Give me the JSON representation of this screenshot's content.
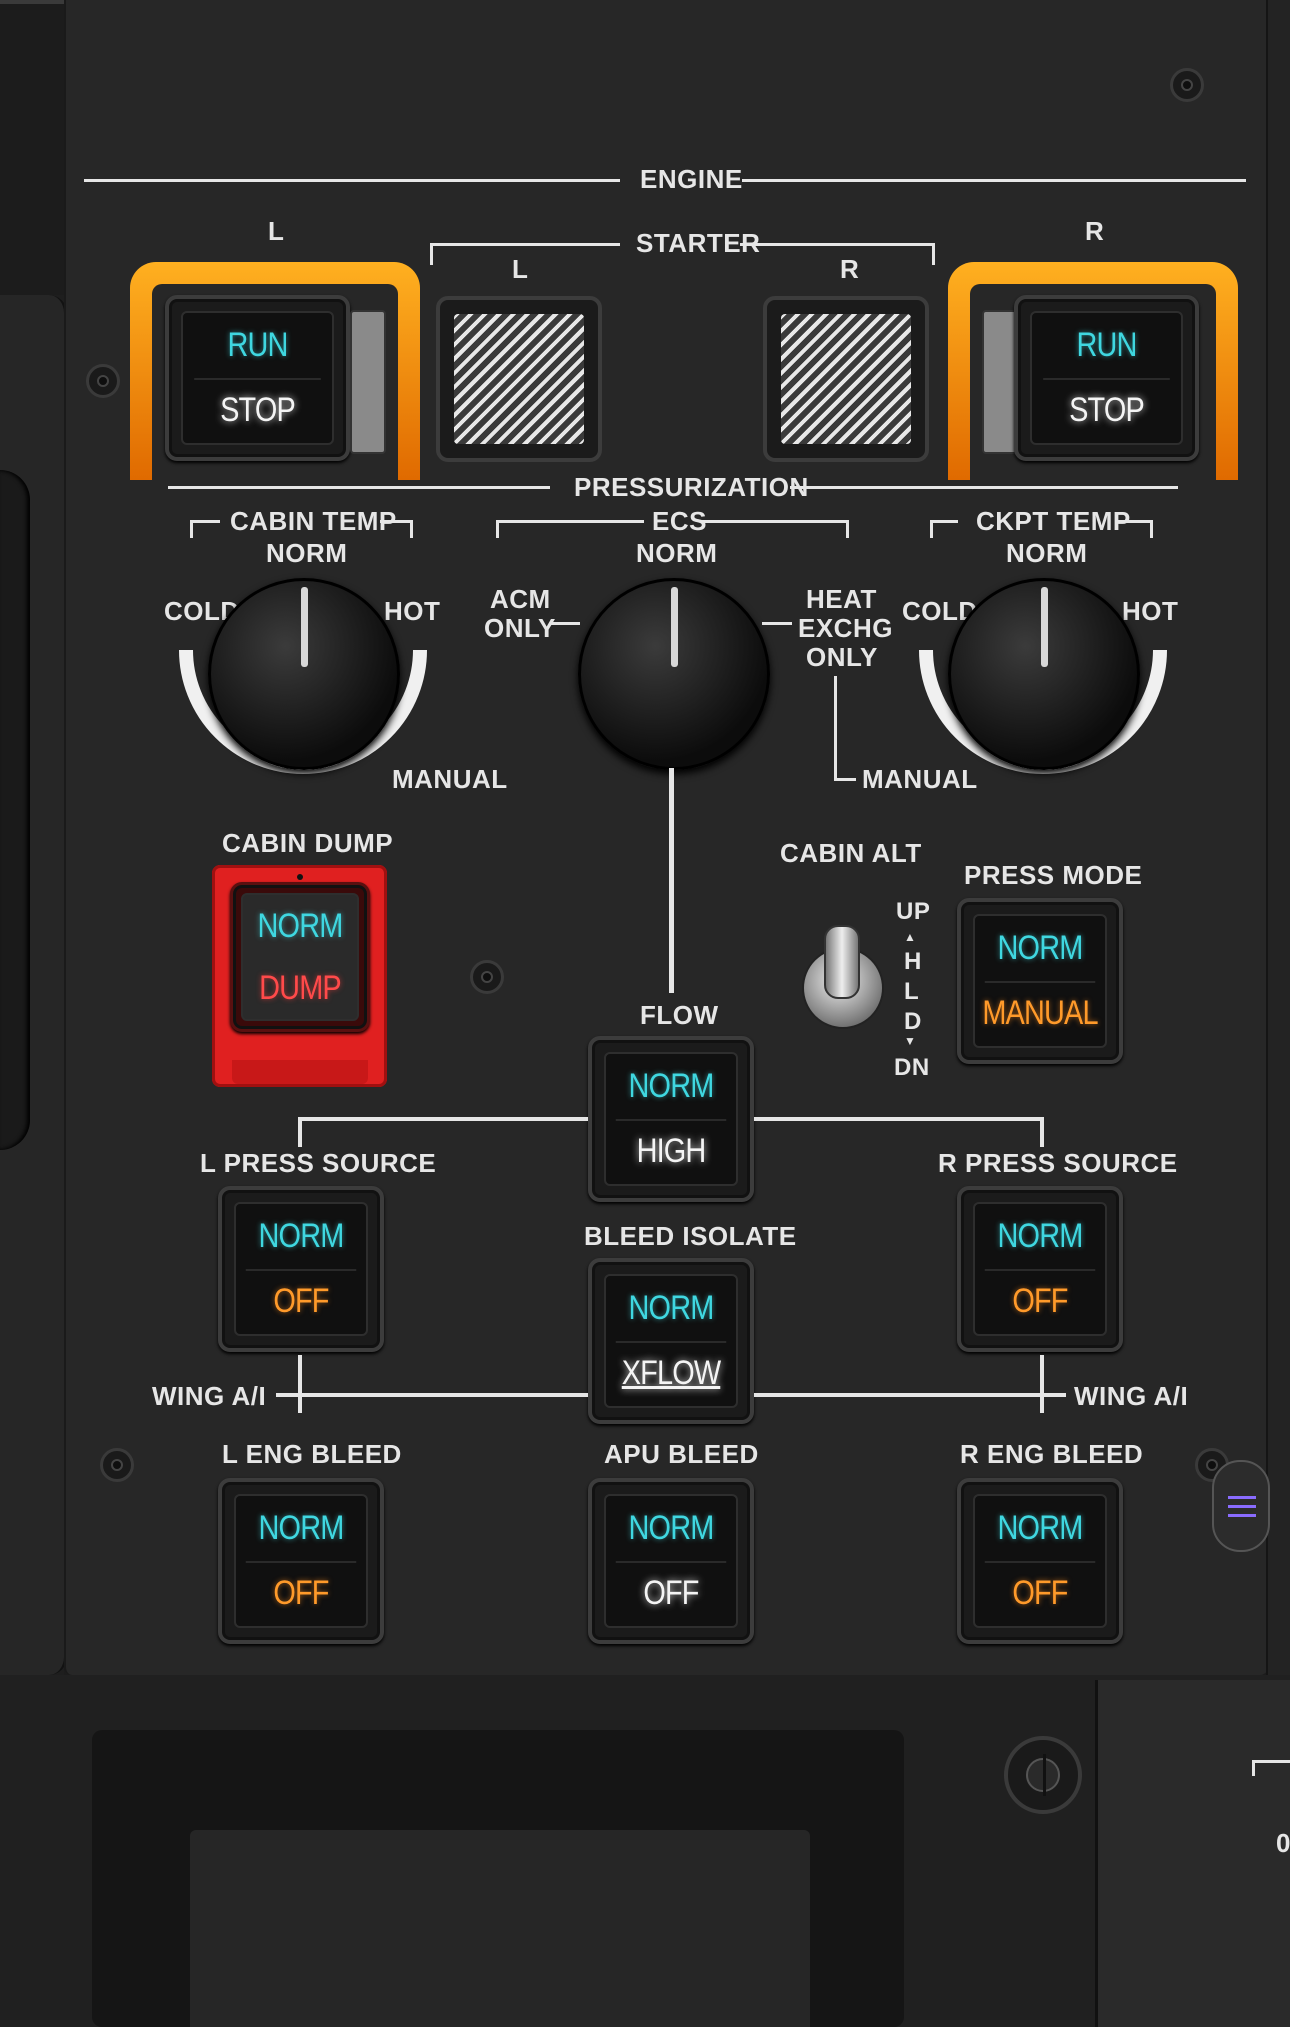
{
  "engine": {
    "title": "ENGINE",
    "left_label": "L",
    "right_label": "R",
    "starter_title": "STARTER",
    "starter_left": "L",
    "starter_right": "R",
    "left_switch": {
      "top": "RUN",
      "bottom": "STOP"
    },
    "right_switch": {
      "top": "RUN",
      "bottom": "STOP"
    }
  },
  "pressurization": {
    "title": "PRESSURIZATION",
    "cabin_temp": {
      "title": "CABIN TEMP",
      "norm": "NORM",
      "cold": "COLD",
      "hot": "HOT",
      "manual": "MANUAL"
    },
    "ecs": {
      "title": "ECS",
      "norm": "NORM",
      "acm_only_1": "ACM",
      "acm_only_2": "ONLY",
      "heat_1": "HEAT",
      "heat_2": "EXCHG",
      "heat_3": "ONLY",
      "manual": "MANUAL"
    },
    "ckpt_temp": {
      "title": "CKPT TEMP",
      "norm": "NORM",
      "cold": "COLD",
      "hot": "HOT"
    }
  },
  "cabin_dump": {
    "title": "CABIN DUMP",
    "top": "NORM",
    "bottom": "DUMP"
  },
  "cabin_alt": {
    "title": "CABIN ALT",
    "up": "UP",
    "hld_h": "H",
    "hld_l": "L",
    "hld_d": "D",
    "dn": "DN"
  },
  "press_mode": {
    "title": "PRESS MODE",
    "top": "NORM",
    "bottom": "MANUAL"
  },
  "flow": {
    "title": "FLOW",
    "top": "NORM",
    "bottom": "HIGH"
  },
  "l_press_source": {
    "title": "L PRESS SOURCE",
    "top": "NORM",
    "bottom": "OFF"
  },
  "r_press_source": {
    "title": "R PRESS SOURCE",
    "top": "NORM",
    "bottom": "OFF"
  },
  "bleed_isolate": {
    "title": "BLEED ISOLATE",
    "top": "NORM",
    "bottom": "XFLOW"
  },
  "wing_ai_left": "WING A/I",
  "wing_ai_right": "WING A/I",
  "l_eng_bleed": {
    "title": "L ENG BLEED",
    "top": "NORM",
    "bottom": "OFF"
  },
  "apu_bleed": {
    "title": "APU BLEED",
    "top": "NORM",
    "bottom": "OFF"
  },
  "r_eng_bleed": {
    "title": "R ENG BLEED",
    "top": "NORM",
    "bottom": "OFF"
  },
  "bottom_right_partial": "0"
}
